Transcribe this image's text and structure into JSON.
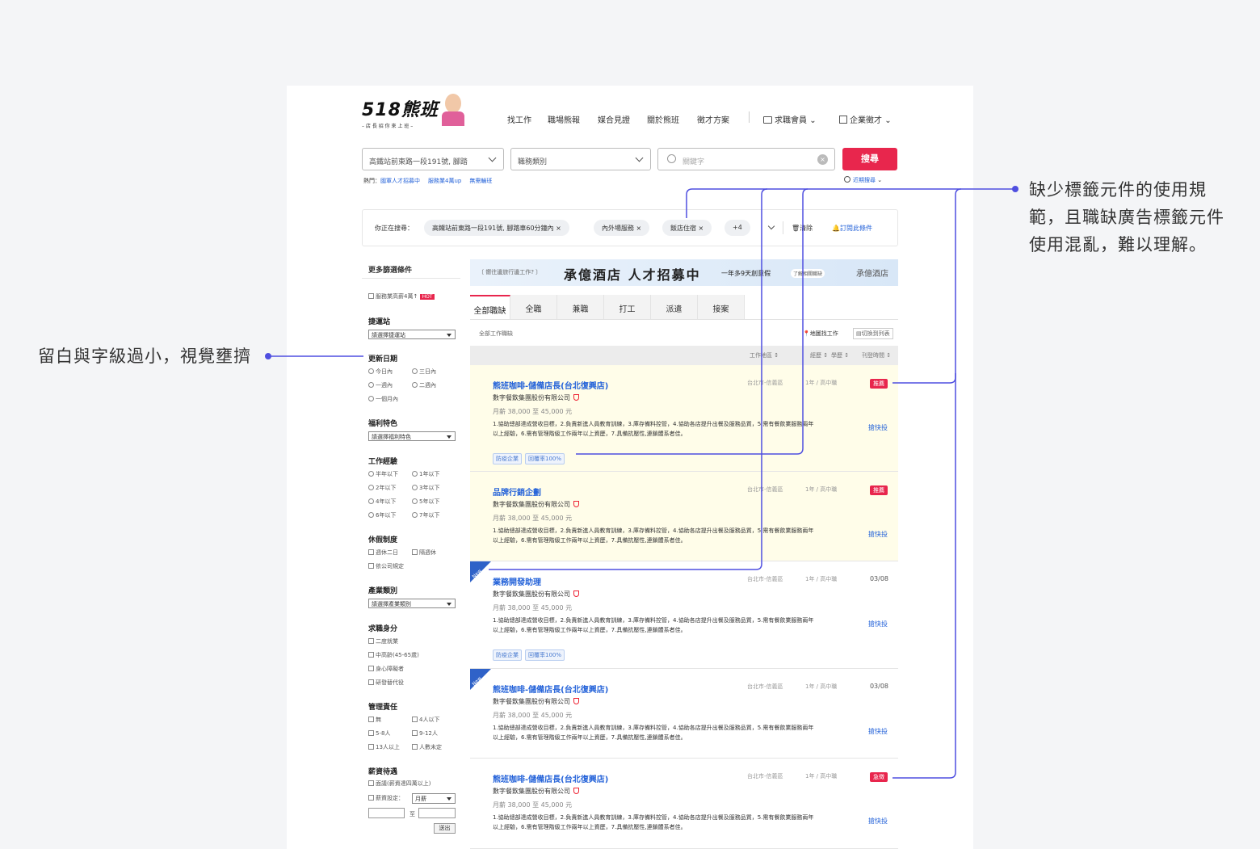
{
  "brand": {
    "logo": "518熊班",
    "slogan": "– 店 長 招 你 來 上 班 –"
  },
  "nav": {
    "items": [
      "找工作",
      "職場熊報",
      "媒合見證",
      "關於熊班",
      "徵才方案"
    ],
    "member": "求職會員",
    "company": "企業徵才"
  },
  "search": {
    "location": "高鐵站前東路一段191號, 腳踏",
    "category": "職務類別",
    "keyword_placeholder": "關鍵字",
    "button": "搜尋",
    "recent": "近期搜尋"
  },
  "hot": {
    "label": "熱門：",
    "links": [
      "國軍人才招募中",
      "服務業4萬up",
      "無需輪班"
    ]
  },
  "current": {
    "label": "你正在搜尋：",
    "chips": [
      "高鐵站前東路一段191號, 腳踏車60分鐘內",
      "內外場服務",
      "飯店住宿"
    ],
    "more": "+4",
    "clear": "清除",
    "subscribe": "訂閱此條件"
  },
  "filters": {
    "title": "更多篩選條件",
    "hot_option": "服務業高薪4萬↑",
    "hot_badge": "HOT",
    "metro": {
      "title": "捷運站",
      "select": "請選擇捷運站"
    },
    "update": {
      "title": "更新日期",
      "options": [
        "今日內",
        "三日內",
        "一週內",
        "二週內",
        "一個月內"
      ]
    },
    "welfare": {
      "title": "福利特色",
      "select": "請選擇福利特色"
    },
    "experience": {
      "title": "工作經驗",
      "options": [
        "半年以下",
        "1年以下",
        "2年以下",
        "3年以下",
        "4年以下",
        "5年以下",
        "6年以下",
        "7年以下"
      ]
    },
    "holiday": {
      "title": "休假制度",
      "options": [
        "週休二日",
        "隔週休",
        "依公司規定"
      ]
    },
    "industry": {
      "title": "產業類別",
      "select": "請選擇產業類別"
    },
    "identity": {
      "title": "求職身分",
      "options": [
        "二度就業",
        "中高齡(45-65歲)",
        "身心障礙者",
        "研發替代役"
      ]
    },
    "manage": {
      "title": "管理責任",
      "options": [
        "無",
        "4人以下",
        "5-8人",
        "9-12人",
        "13人以上",
        "人數未定"
      ]
    },
    "salary": {
      "title": "薪資待遇",
      "opt1": "面議(薪資達四萬以上)",
      "opt2": "薪資設定：",
      "select": "月薪",
      "to": "至",
      "submit": "送出"
    }
  },
  "banner": {
    "left": "〔 嚮往邊旅行邊工作? 〕",
    "main": "承億酒店 人才招募中",
    "sub": "一年多9天創意假",
    "tag": "了解相關職缺",
    "brand": "承億酒店"
  },
  "tabs": [
    "全部職缺",
    "全職",
    "兼職",
    "打工",
    "派遣",
    "接案"
  ],
  "list": {
    "caption": "全部工作職缺",
    "map": "地圖找工作",
    "toggle": "切換到列表",
    "headers": [
      "工作地區",
      "經歷",
      "學歷",
      "刊登時間"
    ]
  },
  "jobs": [
    {
      "title": "熊班咖啡-儲備店長(台北復興店)",
      "company": "數字餐飲集團股份有限公司",
      "salary": "月薪 38,000 至 45,000 元",
      "desc": "1.協助總部達成營收目標，2.負責新進人員教育訓練，3.庫存備料控管，4.協助各店提升出餐及服務品質，5.需有餐飲業服務兩年以上經驗，6.需有管理階級工作兩年以上資歷，7.具備抗壓性,連鎖體系者佳。",
      "location": "台北市-信義區",
      "exp": "1年 / 高中職",
      "badge": "推薦",
      "date": "",
      "apply": "搶快投",
      "tags": [
        "防疫企業",
        "回覆率100%"
      ],
      "new": false
    },
    {
      "title": "品牌行銷企劃",
      "company": "數字餐飲集團股份有限公司",
      "salary": "月薪 38,000 至 45,000 元",
      "desc": "1.協助總部達成營收目標，2.負責新進人員教育訓練，3.庫存備料控管，4.協助各店提升出餐及服務品質，5.需有餐飲業服務兩年以上經驗，6.需有管理階級工作兩年以上資歷，7.具備抗壓性,連鎖體系者佳。",
      "location": "台北市-信義區",
      "exp": "1年 / 高中職",
      "badge": "推薦",
      "date": "",
      "apply": "搶快投",
      "tags": [],
      "new": false
    },
    {
      "title": "業務開發助理",
      "company": "數字餐飲集團股份有限公司",
      "salary": "月薪 38,000 至 45,000 元",
      "desc": "1.協助總部達成營收目標，2.負責新進人員教育訓練，3.庫存備料控管，4.協助各店提升出餐及服務品質，5.需有餐飲業服務兩年以上經驗，6.需有管理階級工作兩年以上資歷，7.具備抗壓性,連鎖體系者佳。",
      "location": "台北市-信義區",
      "exp": "1年 / 高中職",
      "badge": "",
      "date": "03/08",
      "apply": "搶快投",
      "tags": [
        "防疫企業",
        "回覆率100%"
      ],
      "new": true
    },
    {
      "title": "熊班咖啡-儲備店長(台北復興店)",
      "company": "數字餐飲集團股份有限公司",
      "salary": "月薪 38,000 至 45,000 元",
      "desc": "1.協助總部達成營收目標，2.負責新進人員教育訓練，3.庫存備料控管，4.協助各店提升出餐及服務品質，5.需有餐飲業服務兩年以上經驗，6.需有管理階級工作兩年以上資歷，7.具備抗壓性,連鎖體系者佳。",
      "location": "台北市-信義區",
      "exp": "1年 / 高中職",
      "badge": "",
      "date": "03/08",
      "apply": "搶快投",
      "tags": [],
      "new": true
    },
    {
      "title": "熊班咖啡-儲備店長(台北復興店)",
      "company": "數字餐飲集團股份有限公司",
      "salary": "月薪 38,000 至 45,000 元",
      "desc": "1.協助總部達成營收目標，2.負責新進人員教育訓練，3.庫存備料控管，4.協助各店提升出餐及服務品質，5.需有餐飲業服務兩年以上經驗，6.需有管理階級工作兩年以上資歷，7.具備抗壓性,連鎖體系者佳。",
      "location": "台北市-信義區",
      "exp": "1年 / 高中職",
      "badge": "急徵",
      "date": "",
      "apply": "搶快投",
      "tags": [],
      "new": false
    }
  ],
  "annotations": {
    "left": "留白與字級過小，視覺壅擠",
    "right": [
      "缺少標籤元件的使用規",
      "範，且職缺廣告標籤元件",
      "使用混亂，難以理解。"
    ]
  },
  "colors": {
    "accent": "#e8264d",
    "link": "#2563d9",
    "highlight": "#fffde9",
    "annotation_line": "#4f4fe0"
  }
}
